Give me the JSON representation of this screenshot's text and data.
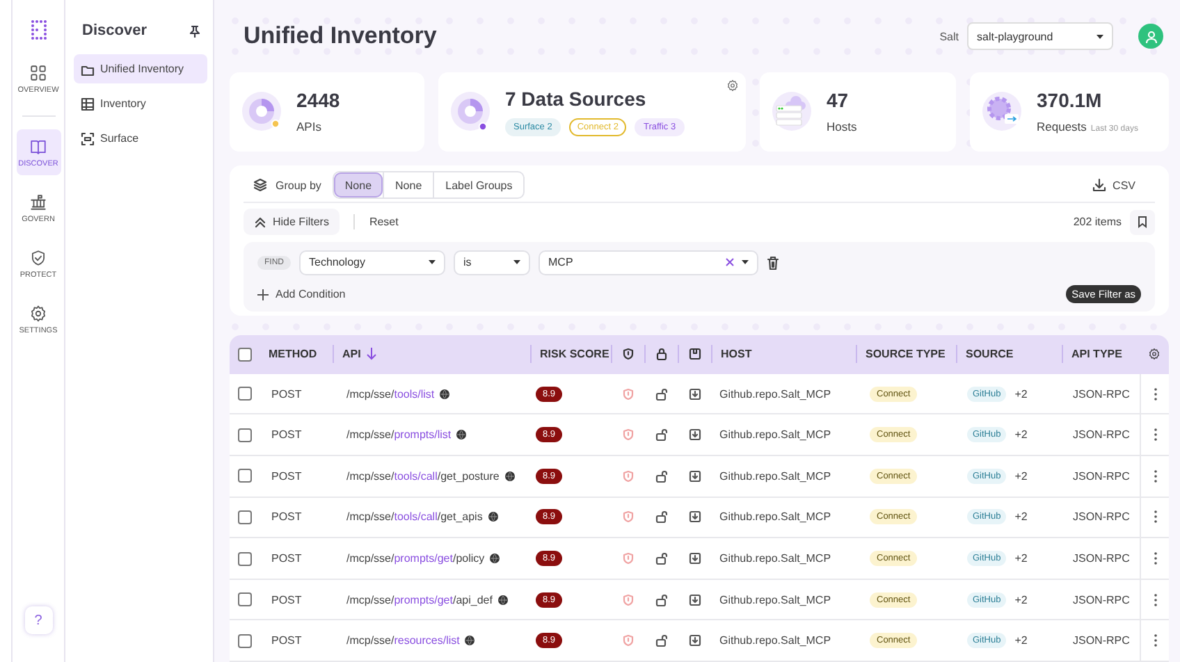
{
  "rail": {
    "items": [
      {
        "label": "OVERVIEW",
        "selected": false
      },
      {
        "label": "DISCOVER",
        "selected": true
      },
      {
        "label": "GOVERN",
        "selected": false
      },
      {
        "label": "PROTECT",
        "selected": false
      },
      {
        "label": "SETTINGS",
        "selected": false
      }
    ],
    "help": "?"
  },
  "sidebar": {
    "title": "Discover",
    "items": [
      {
        "label": "Unified Inventory",
        "selected": true
      },
      {
        "label": "Inventory",
        "selected": false
      },
      {
        "label": "Surface",
        "selected": false
      }
    ]
  },
  "header": {
    "title": "Unified Inventory",
    "tenant_label": "Salt",
    "tenant": "salt-playground"
  },
  "stats": [
    {
      "value": "2448",
      "label": "APIs"
    },
    {
      "value": "7 Data Sources",
      "tags": [
        {
          "label": "Surface 2",
          "kind": "filled",
          "color": "#2b8aa3"
        },
        {
          "label": "Connect 2",
          "kind": "outline",
          "color": "#e2b92c"
        },
        {
          "label": "Traffic 3",
          "kind": "filled",
          "color": "#8a4fe0"
        }
      ]
    },
    {
      "value": "47",
      "label": "Hosts"
    },
    {
      "value": "370.1M",
      "label": "Requests",
      "note": "Last 30 days"
    }
  ],
  "filters": {
    "group_by_label": "Group by",
    "group_options": [
      {
        "label": "None",
        "selected": true
      },
      {
        "label": "None",
        "selected": false
      },
      {
        "label": "Label Groups",
        "selected": false
      }
    ],
    "export": "CSV",
    "hide_filters": "Hide Filters",
    "reset": "Reset",
    "count": "202 items",
    "condition": {
      "find": "FIND",
      "field": "Technology",
      "operator": "is",
      "value": "MCP"
    },
    "add_condition": "Add Condition",
    "save_filter": "Save Filter as"
  },
  "table": {
    "header_checked": false,
    "columns": [
      {
        "label": "METHOD",
        "sorted": false
      },
      {
        "label": "API",
        "sorted": true
      },
      {
        "label": "RISK SCORE",
        "sorted": false
      },
      {
        "label": "HOST",
        "sorted": false
      },
      {
        "label": "SOURCE TYPE",
        "sorted": false
      },
      {
        "label": "SOURCE",
        "sorted": false
      },
      {
        "label": "API TYPE",
        "sorted": false
      }
    ],
    "rows": [
      {
        "checked": false,
        "method": "POST",
        "api": [
          {
            "text": "/mcp/sse/",
            "highlighted": false
          },
          {
            "text": "tools/list",
            "highlighted": true
          }
        ],
        "risk": "8.9",
        "host": "Github.repo.Salt_MCP",
        "source_type": "Connect",
        "source": "GitHub",
        "source_extra": "+2",
        "api_type": "JSON-RPC"
      },
      {
        "checked": false,
        "method": "POST",
        "api": [
          {
            "text": "/mcp/sse/",
            "highlighted": false
          },
          {
            "text": "prompts/list",
            "highlighted": true
          }
        ],
        "risk": "8.9",
        "host": "Github.repo.Salt_MCP",
        "source_type": "Connect",
        "source": "GitHub",
        "source_extra": "+2",
        "api_type": "JSON-RPC"
      },
      {
        "checked": false,
        "method": "POST",
        "api": [
          {
            "text": "/mcp/sse/",
            "highlighted": false
          },
          {
            "text": "tools/call",
            "highlighted": true
          },
          {
            "text": "/get_posture",
            "highlighted": false
          }
        ],
        "risk": "8.9",
        "host": "Github.repo.Salt_MCP",
        "source_type": "Connect",
        "source": "GitHub",
        "source_extra": "+2",
        "api_type": "JSON-RPC"
      },
      {
        "checked": false,
        "method": "POST",
        "api": [
          {
            "text": "/mcp/sse/",
            "highlighted": false
          },
          {
            "text": "tools/call",
            "highlighted": true
          },
          {
            "text": "/get_apis",
            "highlighted": false
          }
        ],
        "risk": "8.9",
        "host": "Github.repo.Salt_MCP",
        "source_type": "Connect",
        "source": "GitHub",
        "source_extra": "+2",
        "api_type": "JSON-RPC"
      },
      {
        "checked": false,
        "method": "POST",
        "api": [
          {
            "text": "/mcp/sse/",
            "highlighted": false
          },
          {
            "text": "prompts/get",
            "highlighted": true
          },
          {
            "text": "/policy",
            "highlighted": false
          }
        ],
        "risk": "8.9",
        "host": "Github.repo.Salt_MCP",
        "source_type": "Connect",
        "source": "GitHub",
        "source_extra": "+2",
        "api_type": "JSON-RPC"
      },
      {
        "checked": false,
        "method": "POST",
        "api": [
          {
            "text": "/mcp/sse/",
            "highlighted": false
          },
          {
            "text": "prompts/get",
            "highlighted": true
          },
          {
            "text": "/api_def",
            "highlighted": false
          }
        ],
        "risk": "8.9",
        "host": "Github.repo.Salt_MCP",
        "source_type": "Connect",
        "source": "GitHub",
        "source_extra": "+2",
        "api_type": "JSON-RPC"
      },
      {
        "checked": false,
        "method": "POST",
        "api": [
          {
            "text": "/mcp/sse/",
            "highlighted": false
          },
          {
            "text": "resources/list",
            "highlighted": true
          }
        ],
        "risk": "8.9",
        "host": "Github.repo.Salt_MCP",
        "source_type": "Connect",
        "source": "GitHub",
        "source_extra": "+2",
        "api_type": "JSON-RPC"
      }
    ]
  }
}
